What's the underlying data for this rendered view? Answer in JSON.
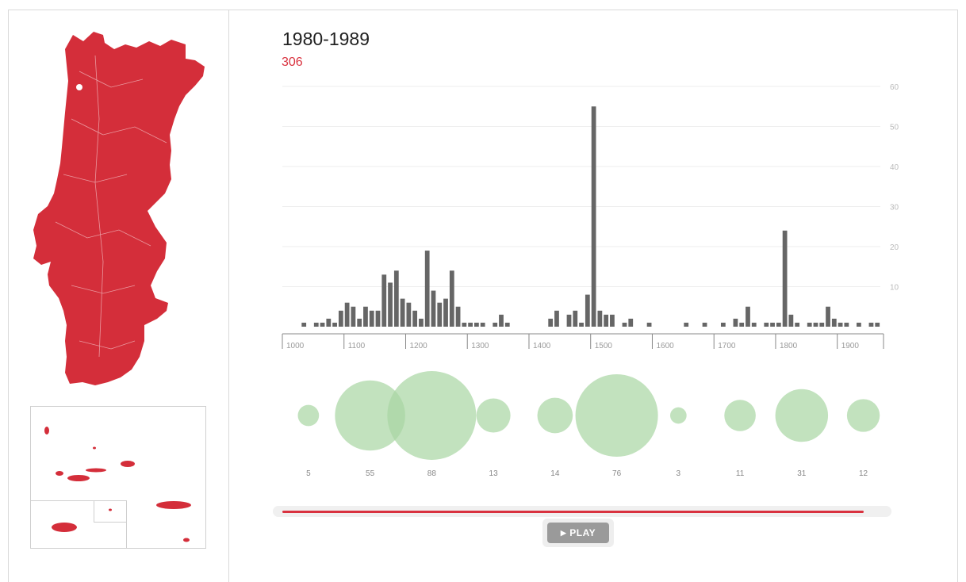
{
  "header": {
    "period": "1980-1989",
    "count": "306"
  },
  "colors": {
    "map_fill": "#d42e3a",
    "bar_fill": "#666666",
    "bubble_fill": "#a8d5a2",
    "accent": "#d9323f",
    "grid": "#eeeeee",
    "axis_label": "#bbbbbb"
  },
  "controls": {
    "play_label": "PLAY",
    "play_icon": "play-icon",
    "progress": 0.97
  },
  "chart_data": [
    {
      "type": "bar",
      "title": "",
      "xlabel": "",
      "ylabel": "",
      "xlim": [
        1000,
        1975
      ],
      "ylim": [
        0,
        60
      ],
      "y_ticks": [
        10,
        20,
        30,
        40,
        50,
        60
      ],
      "x_ticks": [
        {
          "value": 1000,
          "label": "1000"
        },
        {
          "value": 1100,
          "label": "1100"
        },
        {
          "value": 1200,
          "label": "1200"
        },
        {
          "value": 1300,
          "label": "1300"
        },
        {
          "value": 1400,
          "label": "1400"
        },
        {
          "value": 1500,
          "label": "1500"
        },
        {
          "value": 1600,
          "label": "1600"
        },
        {
          "value": 1700,
          "label": "1700"
        },
        {
          "value": 1800,
          "label": "1800"
        },
        {
          "value": 1900,
          "label": "1900"
        }
      ],
      "grid": true,
      "bin_width": 10,
      "x": [
        1030,
        1050,
        1060,
        1070,
        1080,
        1090,
        1100,
        1110,
        1120,
        1130,
        1140,
        1150,
        1160,
        1170,
        1180,
        1190,
        1200,
        1210,
        1220,
        1230,
        1240,
        1250,
        1260,
        1270,
        1280,
        1290,
        1300,
        1310,
        1320,
        1340,
        1350,
        1360,
        1430,
        1440,
        1460,
        1470,
        1480,
        1490,
        1500,
        1510,
        1520,
        1530,
        1550,
        1560,
        1590,
        1650,
        1680,
        1710,
        1730,
        1740,
        1750,
        1760,
        1780,
        1790,
        1800,
        1810,
        1820,
        1830,
        1850,
        1860,
        1870,
        1880,
        1890,
        1900,
        1910,
        1930,
        1950,
        1960
      ],
      "values": [
        1,
        1,
        1,
        2,
        1,
        4,
        6,
        5,
        2,
        5,
        4,
        4,
        13,
        11,
        14,
        7,
        6,
        4,
        2,
        19,
        9,
        6,
        7,
        14,
        5,
        1,
        1,
        1,
        1,
        1,
        3,
        1,
        2,
        4,
        3,
        4,
        1,
        8,
        55,
        4,
        3,
        3,
        1,
        2,
        1,
        1,
        1,
        1,
        2,
        1,
        5,
        1,
        1,
        1,
        1,
        24,
        3,
        1,
        1,
        1,
        1,
        5,
        2,
        1,
        1,
        1,
        1,
        1
      ]
    },
    {
      "type": "scatter",
      "title": "",
      "x": [
        1050,
        1150,
        1250,
        1350,
        1450,
        1550,
        1650,
        1750,
        1850,
        1950
      ],
      "sizes": [
        5,
        55,
        88,
        13,
        14,
        76,
        3,
        11,
        31,
        12
      ],
      "labels": [
        "5",
        "55",
        "88",
        "13",
        "14",
        "76",
        "3",
        "11",
        "31",
        "12"
      ]
    }
  ]
}
